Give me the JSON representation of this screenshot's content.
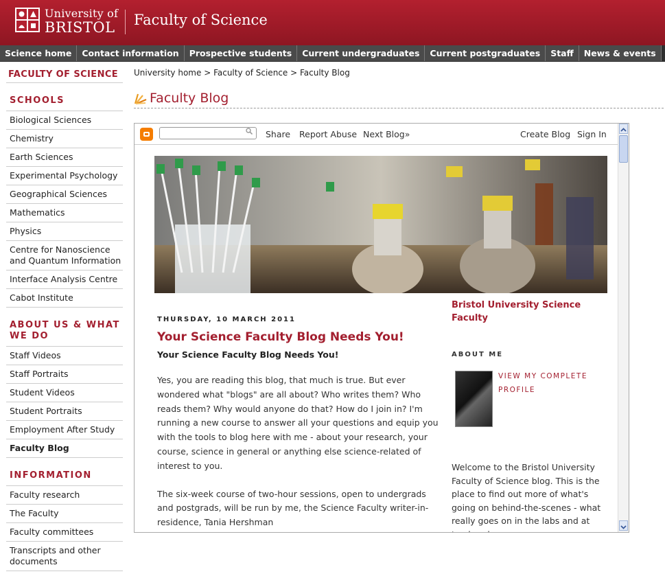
{
  "header": {
    "university_line1": "University of",
    "university_line2": "BRISTOL",
    "faculty_title": "Faculty of Science"
  },
  "nav": {
    "items": [
      "Science home",
      "Contact information",
      "Prospective students",
      "Current undergraduates",
      "Current postgraduates",
      "Staff",
      "News & events"
    ]
  },
  "sidebar": {
    "faculty_link": "FACULTY OF SCIENCE",
    "schools_heading": "SCHOOLS",
    "schools": [
      "Biological Sciences",
      "Chemistry",
      "Earth Sciences",
      "Experimental Psychology",
      "Geographical Sciences",
      "Mathematics",
      "Physics",
      "Centre for Nanoscience and Quantum Information",
      "Interface Analysis Centre",
      "Cabot Institute"
    ],
    "about_heading": "ABOUT US & WHAT WE DO",
    "about": [
      "Staff Videos",
      "Staff Portraits",
      "Student Videos",
      "Student Portraits",
      "Employment After Study",
      "Faculty Blog"
    ],
    "info_heading": "INFORMATION",
    "info": [
      "Faculty research",
      "The Faculty",
      "Faculty committees",
      "Transcripts and other documents"
    ]
  },
  "breadcrumb": {
    "items": [
      "University home",
      "Faculty of Science",
      "Faculty Blog"
    ],
    "separator": " > "
  },
  "page_title": "Faculty Blog",
  "blogger_bar": {
    "search_placeholder": "",
    "share": "Share",
    "report_abuse": "Report Abuse",
    "next_blog": "Next Blog»",
    "create_blog": "Create Blog",
    "sign_in": "Sign In"
  },
  "post": {
    "date": "THURSDAY, 10 MARCH 2011",
    "title": "Your Science Faculty Blog Needs You!",
    "subtitle": "Your Science Faculty Blog Needs You!",
    "para1": "Yes, you are reading this blog, that much is true. But ever wondered what \"blogs\" are all about? Who writes them? Who reads  them? Why would anyone do that? How do I join in? I'm running a new course to answer  all your questions and equip you with the tools to blog here with me  - about your research, your course, science in general or anything else science-related of interest to you.",
    "para2": "The six-week course of two-hour sessions, open to undergrads and postgrads, will be run by me, the Science Faculty writer-in-residence, Tania Hershman"
  },
  "blog_sidebar": {
    "blog_name": "Bristol University Science Faculty",
    "about_heading": "ABOUT ME",
    "profile_link": "VIEW MY COMPLETE PROFILE",
    "welcome": "Welcome to the Bristol University Faculty of Science blog. This is the place to find out more of what's going on behind-the-scenes - what really goes on in the labs and at tea break"
  },
  "colors": {
    "brand_red": "#a31f2f",
    "nav_gray": "#4a4a4a",
    "blogger_orange": "#f57d00"
  }
}
